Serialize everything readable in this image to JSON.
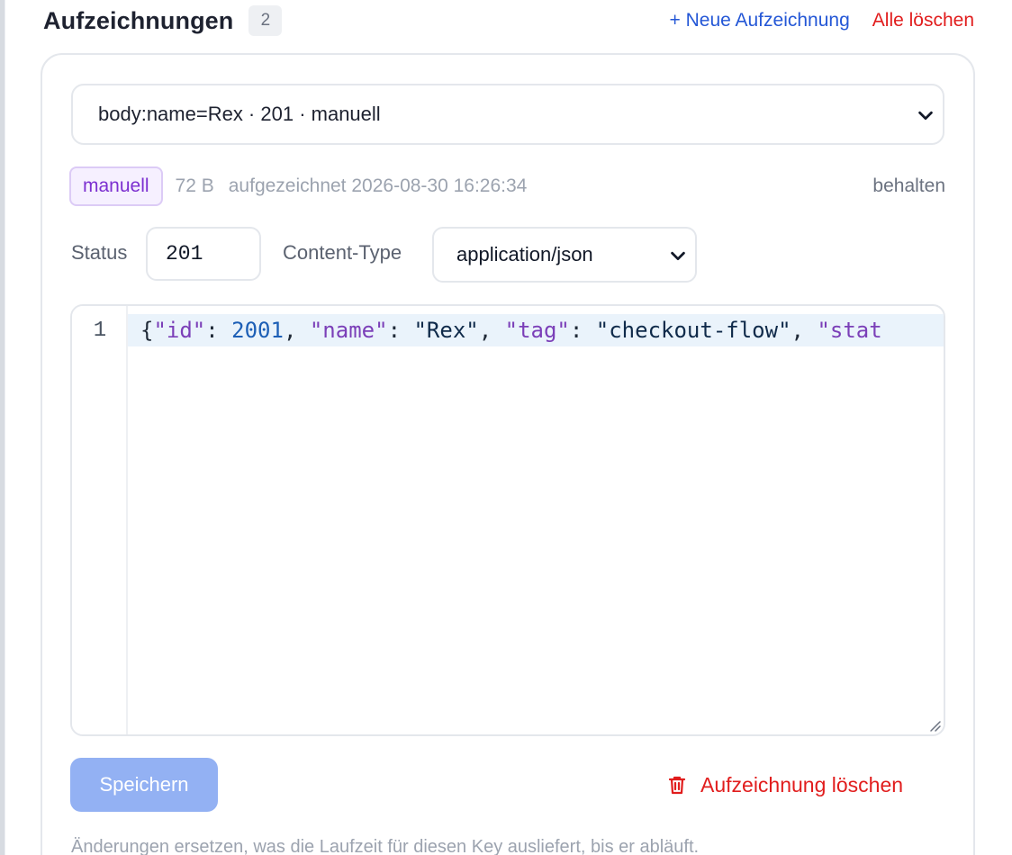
{
  "header": {
    "title": "Aufzeichnungen",
    "count": "2",
    "new_recording": "+ Neue Aufzeichnung",
    "clear_all": "Alle löschen"
  },
  "recording": {
    "selected": "body:name=Rex · 201 · manuell",
    "mode_badge": "manuell",
    "size": "72 B",
    "recorded_at": "aufgezeichnet 2026-08-30 16:26:34",
    "keep": "behalten"
  },
  "response": {
    "status_label": "Status",
    "status_value": "201",
    "content_type_label": "Content-Type",
    "content_type_value": "application/json"
  },
  "editor": {
    "line_number": "1",
    "tokens": [
      {
        "t": "{",
        "k": "punct"
      },
      {
        "t": "\"id\"",
        "k": "key"
      },
      {
        "t": ": ",
        "k": "punct"
      },
      {
        "t": "2001",
        "k": "num"
      },
      {
        "t": ", ",
        "k": "punct"
      },
      {
        "t": "\"name\"",
        "k": "key"
      },
      {
        "t": ": ",
        "k": "punct"
      },
      {
        "t": "\"Rex\"",
        "k": "str"
      },
      {
        "t": ", ",
        "k": "punct"
      },
      {
        "t": "\"tag\"",
        "k": "key"
      },
      {
        "t": ": ",
        "k": "punct"
      },
      {
        "t": "\"checkout-flow\"",
        "k": "str"
      },
      {
        "t": ", ",
        "k": "punct"
      },
      {
        "t": "\"stat",
        "k": "key"
      }
    ]
  },
  "actions": {
    "save": "Speichern",
    "delete_recording": "Aufzeichnung löschen"
  },
  "footnote": "Änderungen ersetzen, was die Laufzeit für diesen Key ausliefert, bis er abläuft.",
  "icons": {
    "select_chevron": "chevron-down-icon",
    "delete": "trash-icon",
    "resize": "resize-handle-icon"
  },
  "colors": {
    "link_blue": "#2457d6",
    "danger_red": "#e11d1d",
    "badge_purple": "#7c2fd0",
    "save_disabled": "#93b1f3"
  }
}
